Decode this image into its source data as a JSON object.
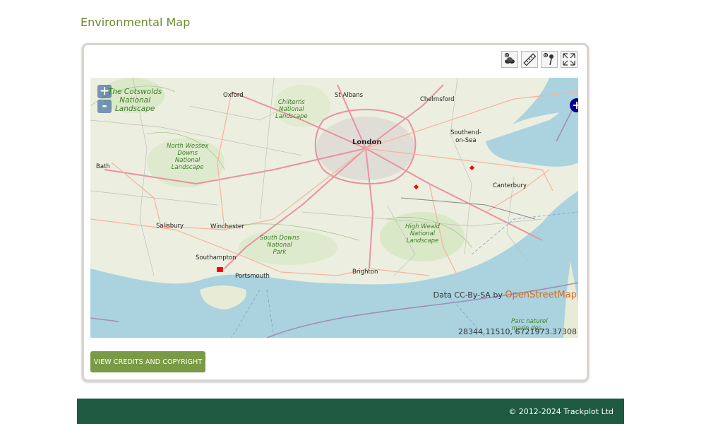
{
  "page": {
    "title": "Environmental Map"
  },
  "toolbar": {
    "tools": [
      {
        "icon": "layers-eye-icon"
      },
      {
        "icon": "ruler-icon"
      },
      {
        "icon": "pin-eye-icon"
      },
      {
        "icon": "fullscreen-icon"
      }
    ]
  },
  "map": {
    "zoom_in": "+",
    "zoom_out": "-",
    "layer_switcher": "+",
    "attribution_prefix": "Data CC-By-SA by",
    "attribution_link": "OpenStreetMap",
    "coordinates": "28344.11510, 6721973.37308",
    "places": {
      "oxford": "Oxford",
      "st_albans": "St Albans",
      "chelmsford": "Chelmsford",
      "southend": "Southend-\non-Sea",
      "london": "London",
      "bath": "Bath",
      "canterbury": "Canterbury",
      "salisbury": "Salisbury",
      "winchester": "Winchester",
      "southampton": "Southampton",
      "portsmouth": "Portsmouth",
      "brighton": "Brighton"
    },
    "parks": {
      "cotswolds": "The Cotswolds\nNational\nLandscape",
      "chilterns": "Chilterns\nNational\nLandscape",
      "north_wessex": "North Wessex\nDowns\nNational\nLandscape",
      "south_downs": "South Downs\nNational\nPark",
      "high_weald": "High Weald\nNational\nLandscape",
      "parc": "Parc naturel\nmarin des..."
    }
  },
  "buttons": {
    "credits": "VIEW CREDITS AND COPYRIGHT"
  },
  "footer": {
    "copyright": "© 2012-2024 Trackplot Ltd"
  }
}
